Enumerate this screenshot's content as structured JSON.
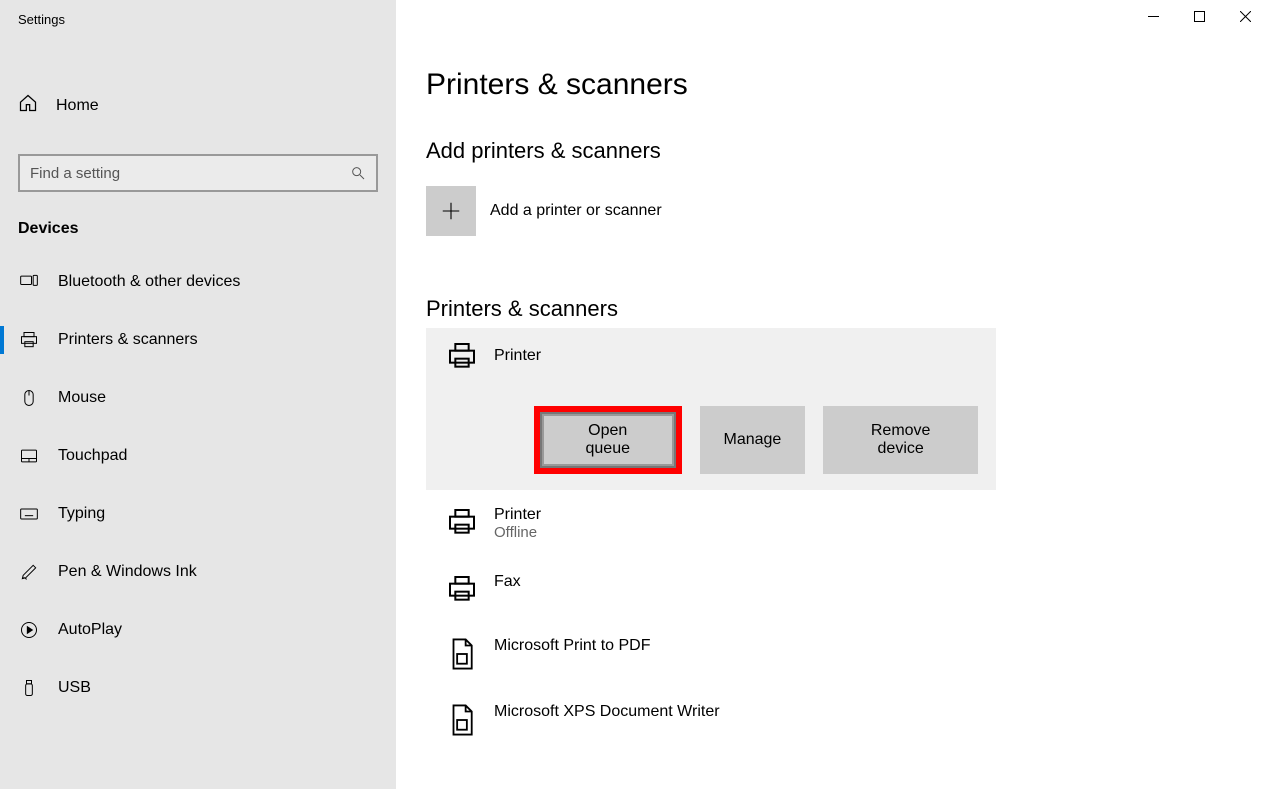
{
  "window_title": "Settings",
  "home_label": "Home",
  "search_placeholder": "Find a setting",
  "category": "Devices",
  "nav": [
    {
      "label": "Bluetooth & other devices"
    },
    {
      "label": "Printers & scanners"
    },
    {
      "label": "Mouse"
    },
    {
      "label": "Touchpad"
    },
    {
      "label": "Typing"
    },
    {
      "label": "Pen & Windows Ink"
    },
    {
      "label": "AutoPlay"
    },
    {
      "label": "USB"
    }
  ],
  "page_title": "Printers & scanners",
  "add_section": "Add printers & scanners",
  "add_label": "Add a printer or scanner",
  "list_section": "Printers & scanners",
  "selected_printer": "Printer",
  "buttons": {
    "open_queue": "Open queue",
    "manage": "Manage",
    "remove": "Remove device"
  },
  "items": [
    {
      "name": "Printer",
      "status": "Offline",
      "icon": "printer"
    },
    {
      "name": "Fax",
      "status": "",
      "icon": "printer"
    },
    {
      "name": "Microsoft Print to PDF",
      "status": "",
      "icon": "document"
    },
    {
      "name": "Microsoft XPS Document Writer",
      "status": "",
      "icon": "document"
    }
  ]
}
